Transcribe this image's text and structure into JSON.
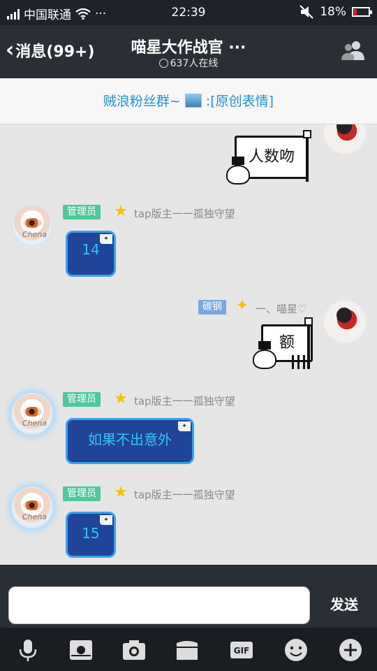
{
  "status_bar": {
    "carrier": "中国联通",
    "more": "···",
    "time": "22:39",
    "battery": "18%",
    "battery_level": 0.18
  },
  "nav": {
    "back_label": "消息(99+)",
    "title": "喵星大作战官 ···",
    "subtitle": "637人在线"
  },
  "announcement": {
    "prefix": "贼浪粉丝群~",
    "suffix": ":[原创表情]"
  },
  "messages": [
    {
      "id": "m0",
      "side": "right",
      "sticker_text": "人数吻"
    },
    {
      "id": "m1",
      "side": "left",
      "tag": "管理员",
      "name": "tap版主一一孤独守望",
      "avatar_text": "Chena",
      "text": "14"
    },
    {
      "id": "m2",
      "side": "right",
      "tag": "碳钢",
      "name": "一、喵星♡",
      "sticker_text": "额"
    },
    {
      "id": "m3",
      "side": "left",
      "tag": "管理员",
      "name": "tap版主一一孤独守望",
      "avatar_text": "Chena",
      "text": "如果不出意外"
    },
    {
      "id": "m4",
      "side": "left",
      "tag": "管理员",
      "name": "tap版主一一孤独守望",
      "avatar_text": "Chena",
      "text": "15"
    }
  ],
  "input": {
    "value": "",
    "send_label": "发送"
  },
  "toolbar": {
    "items": [
      "mic-icon",
      "sun-icon",
      "camera-icon",
      "folder-icon",
      "gif-icon",
      "emoji-icon",
      "plus-icon"
    ],
    "gif_label": "GIF"
  },
  "colors": {
    "status_bg": "#1e2329",
    "nav_bg": "#2a2f36",
    "chat_bg": "#e6e6e6",
    "accent_blue": "#2a8fd0",
    "admin_tag": "#4fc79a",
    "member_tag": "#7aa7e0",
    "bubble_bg": "#20449a",
    "bubble_border": "#3aa3ea",
    "bubble_text": "#38c3f0"
  }
}
